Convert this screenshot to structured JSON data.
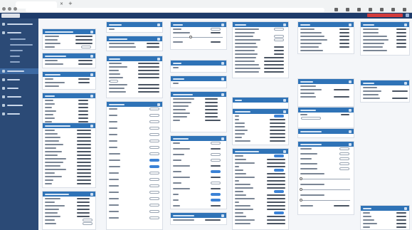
{
  "ui": {
    "colors": {
      "header": "#1d3b6a",
      "sidebar": "#2b4a76",
      "sidebar_active": "#3d6aa3",
      "card_header": "#2f73b7",
      "toggle_on": "#3b82d6",
      "alert_button": "#d23b3b"
    },
    "icons": [
      "back-icon",
      "forward-icon",
      "reload-icon",
      "lock-icon",
      "star-icon",
      "extension-icon",
      "profile-icon",
      "menu-icon",
      "widget-menu-icon"
    ]
  }
}
